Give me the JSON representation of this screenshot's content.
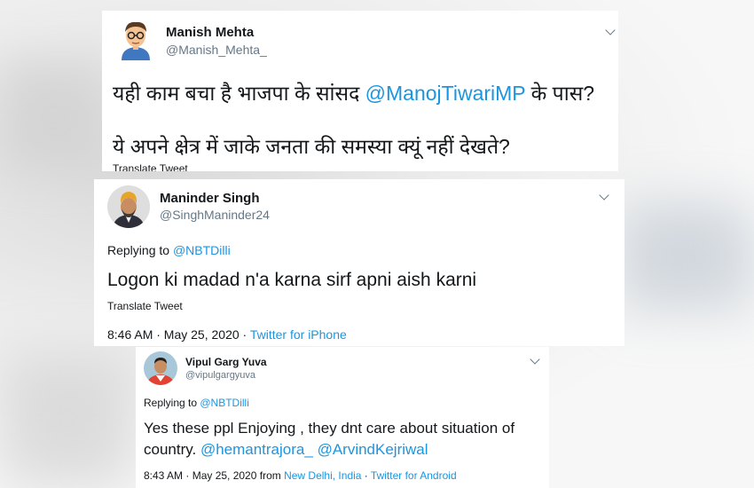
{
  "tweet1": {
    "name": "Manish Mehta",
    "handle": "@Manish_Mehta_",
    "line1_text": "यही काम बचा है भाजपा के सांसद ",
    "line1_mention": "@ManojTiwariMP",
    "line1_end": " के पास?",
    "line2": "ये अपने क्षेत्र में जाके जनता की समस्या क्यूं नहीं देखते?",
    "translate": "Translate Tweet",
    "menu_icon": "chevron-down-icon",
    "avatar_icon": "cartoon-avatar-icon"
  },
  "tweet2": {
    "name": "Maninder Singh",
    "handle": "@SinghManinder24",
    "replying_prefix": "Replying to ",
    "replying_to": "@NBTDilli",
    "text": "Logon ki madad n'a karna sirf apni aish karni",
    "translate": "Translate Tweet",
    "meta": "8:46 AM · May 25, 2020 · ",
    "source": "Twitter for iPhone",
    "menu_icon": "chevron-down-icon"
  },
  "tweet3": {
    "name": "Vipul Garg Yuva",
    "handle": "@vipulgargyuva",
    "replying_prefix": "Replying to ",
    "replying_to": "@NBTDilli",
    "line1": "Yes these ppl Enjoying , they dnt care about situation of",
    "line2_text": "country. ",
    "mention1": "@hemantrajora_",
    "mention2": "@ArvindKejriwal",
    "meta": "8:43 AM · May 25, 2020 from ",
    "location": "New Delhi, India",
    "sep": " · ",
    "source": "Twitter for Android",
    "menu_icon": "chevron-down-icon"
  }
}
